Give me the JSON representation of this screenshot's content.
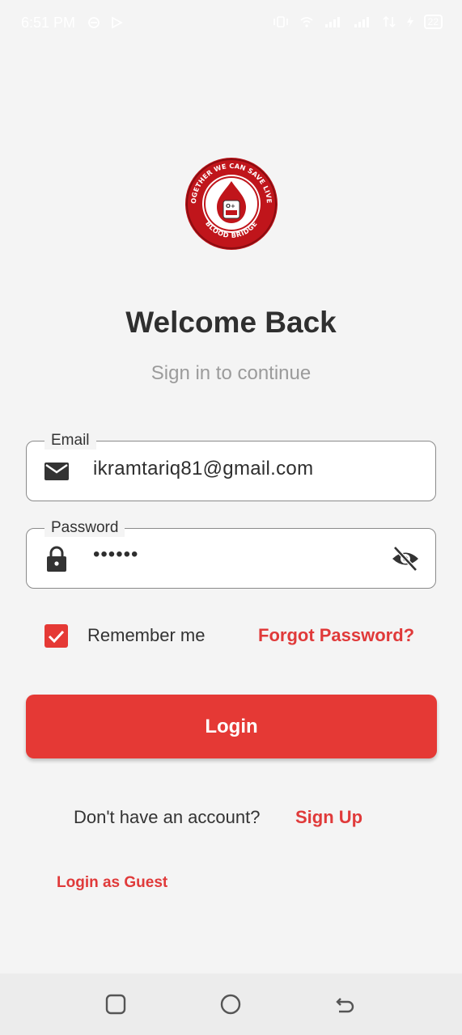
{
  "status_bar": {
    "time": "6:51 PM",
    "battery": "22"
  },
  "logo": {
    "ring_text": "TOGETHER WE CAN SAVE LIVES",
    "bottom_text": "BLOOD BRIDGE",
    "bag_label": "O+",
    "color": "#c0151b"
  },
  "header": {
    "title": "Welcome Back",
    "subtitle": "Sign in to continue"
  },
  "form": {
    "email": {
      "label": "Email",
      "value": "ikramtariq81@gmail.com",
      "icon": "mail-icon"
    },
    "password": {
      "label": "Password",
      "value": "••••••",
      "icon": "lock-icon",
      "toggle_icon": "eye-off-icon"
    },
    "remember_me": {
      "label": "Remember me",
      "checked": true
    },
    "forgot_password": "Forgot Password?",
    "login_button": "Login"
  },
  "footer": {
    "no_account": "Don't have an account?",
    "sign_up": "Sign Up",
    "guest": "Login as Guest"
  },
  "colors": {
    "accent": "#e53935",
    "background": "#f4f4f4"
  }
}
